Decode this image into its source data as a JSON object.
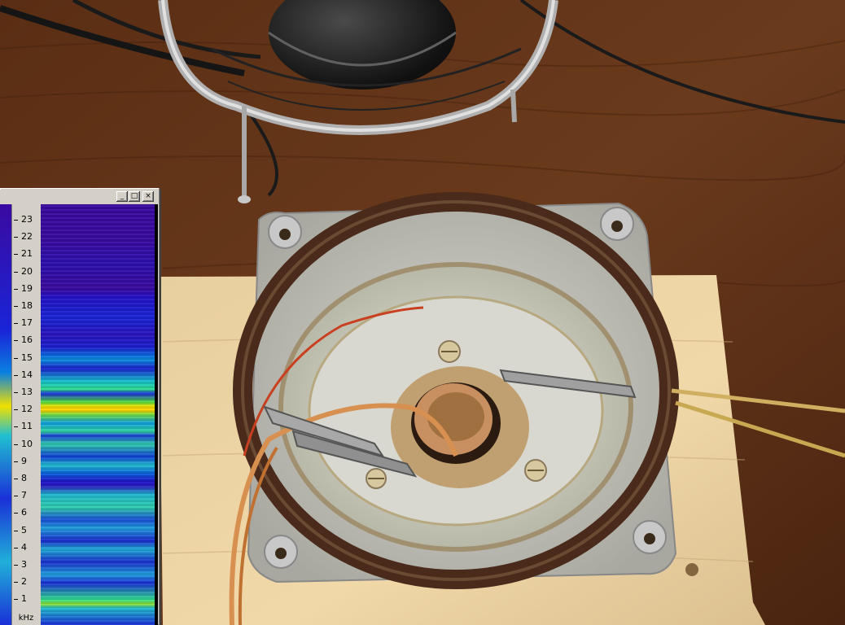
{
  "window": {
    "buttons": [
      "_",
      "□",
      "×"
    ],
    "axis_unit": "kHz",
    "ticks": [
      "23",
      "22",
      "21",
      "20",
      "19",
      "18",
      "17",
      "16",
      "15",
      "14",
      "13",
      "12",
      "11",
      "10",
      "9",
      "8",
      "7",
      "6",
      "5",
      "4",
      "3",
      "2",
      "1"
    ]
  },
  "icons": {
    "minimize": "minimize-icon",
    "maximize": "maximize-icon",
    "close": "close-icon"
  }
}
